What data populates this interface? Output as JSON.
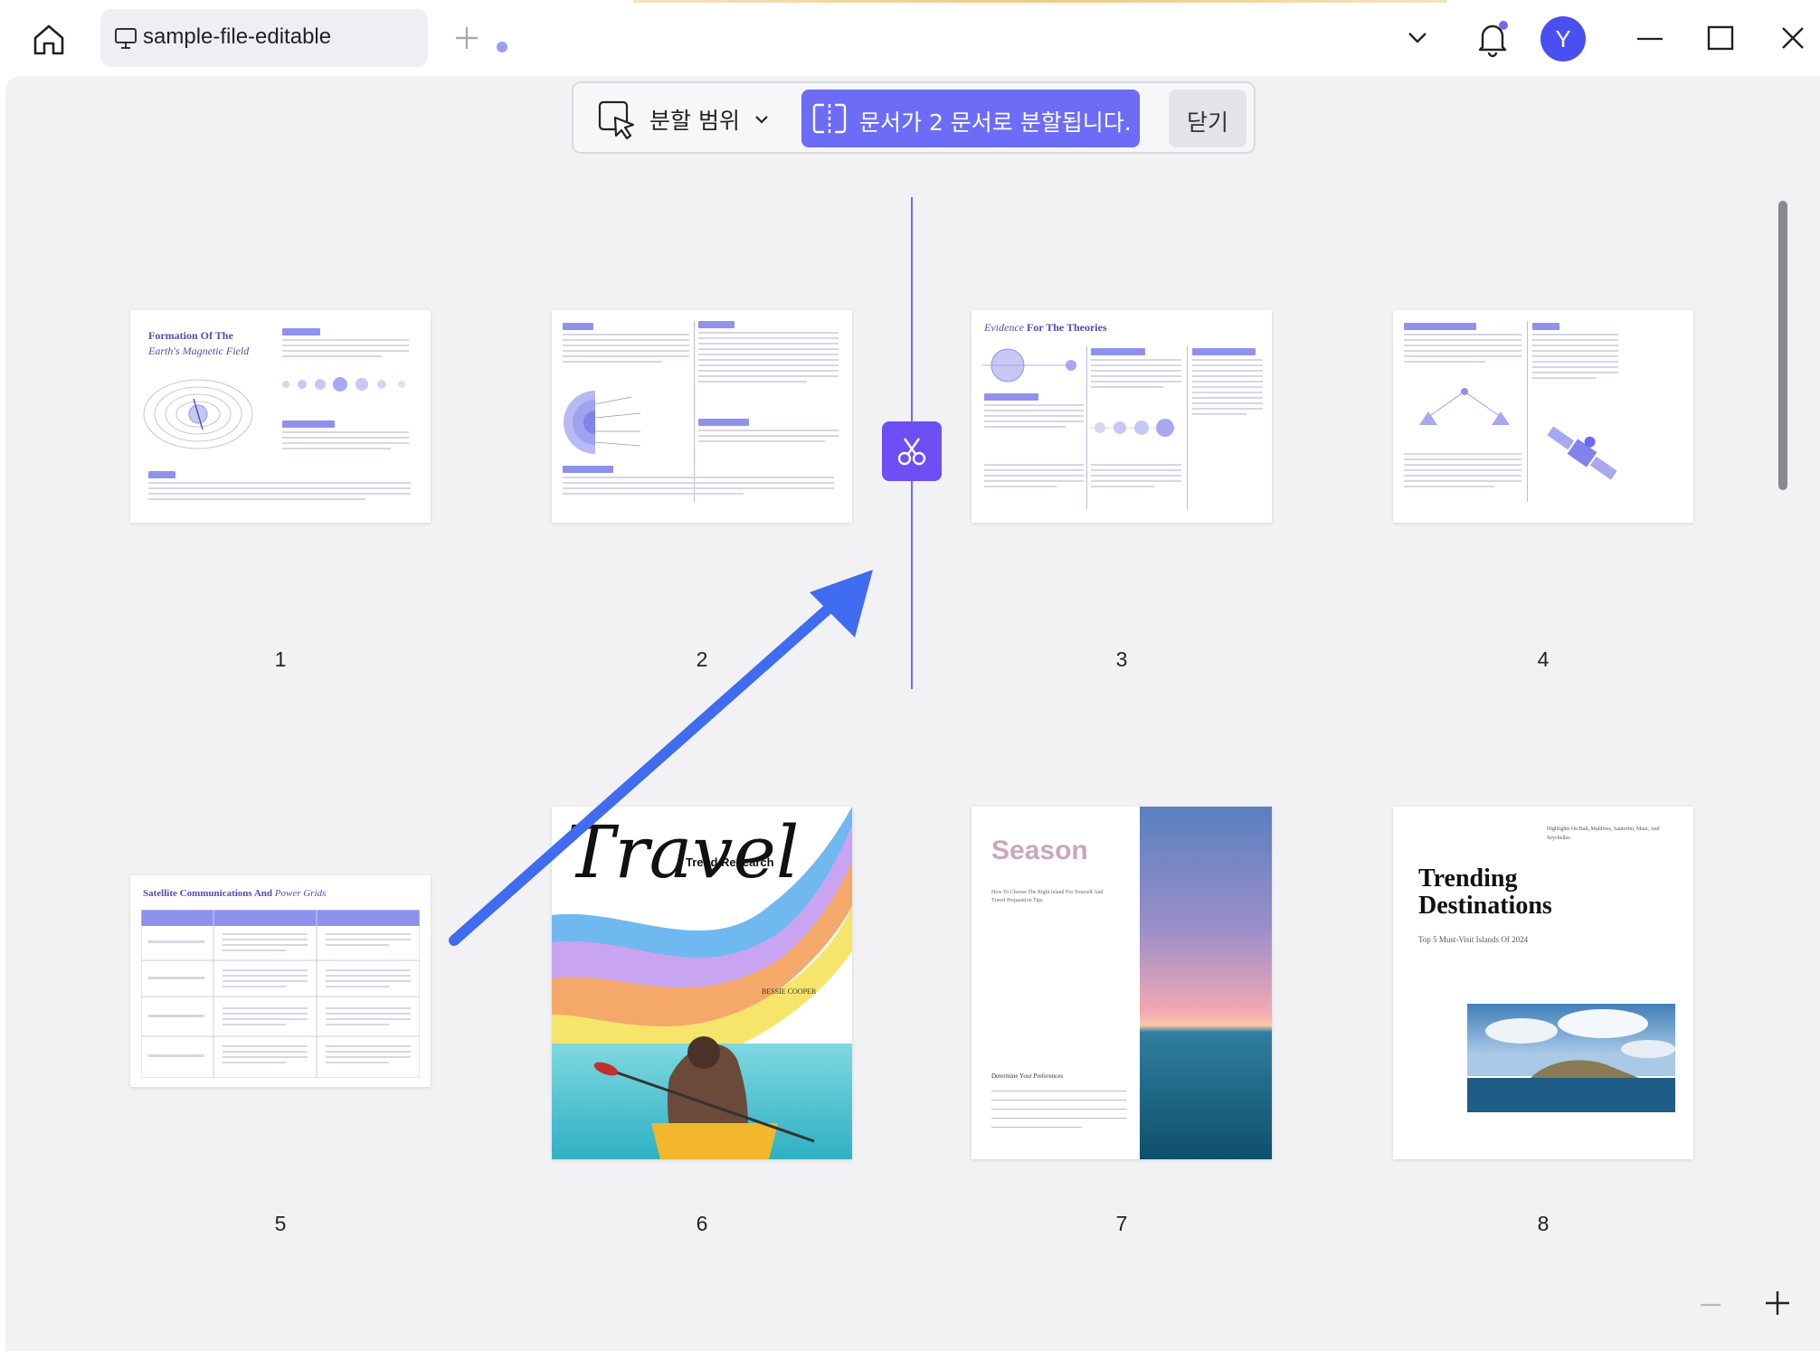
{
  "tab": {
    "title": "sample-file-editable"
  },
  "profile": {
    "initial": "Y"
  },
  "toolbar": {
    "range_label": "분할 범위",
    "split_info": "문서가 2 문서로 분할됩니다.",
    "close_label": "닫기"
  },
  "pages": [
    {
      "number": "1",
      "title_line1": "Formation Of The",
      "title_line2": "Earth's Magnetic Field"
    },
    {
      "number": "2"
    },
    {
      "number": "3",
      "title_italic": "Evidence",
      "title_rest": " For The Theories"
    },
    {
      "number": "4"
    },
    {
      "number": "5",
      "title_plain": "Satellite Communications And",
      "title_italic": "Power Grids"
    },
    {
      "number": "6",
      "script_title": "Travel",
      "subtitle": "Trend Research",
      "author": "BESSIE COOPER"
    },
    {
      "number": "7",
      "title": "Season",
      "subtitle_line1": "How To Choose The Right Island For Yourself And",
      "subtitle_line2": "Travel Preparation Tips",
      "section": "Determine Your Preferences"
    },
    {
      "number": "8",
      "kicker": "Highlights On Bali, Maldives, Santorini, Maui, And Seychelles",
      "title_line1": "Trending",
      "title_line2": "Destinations",
      "subtitle": "Top 5 Must-Visit Islands Of 2024"
    }
  ],
  "colors": {
    "accent": "#6c6cf7",
    "scissors": "#6e4ff5",
    "annotation_arrow": "#3f6cf0",
    "workspace": "#f2f2f4"
  },
  "icons": [
    "home-icon",
    "presentation-icon",
    "plus-icon",
    "chevron-down-icon",
    "bell-icon",
    "minimize-icon",
    "maximize-icon",
    "close-icon",
    "cursor-select-icon",
    "split-icon",
    "scissors-icon",
    "zoom-out-icon",
    "zoom-in-icon"
  ]
}
